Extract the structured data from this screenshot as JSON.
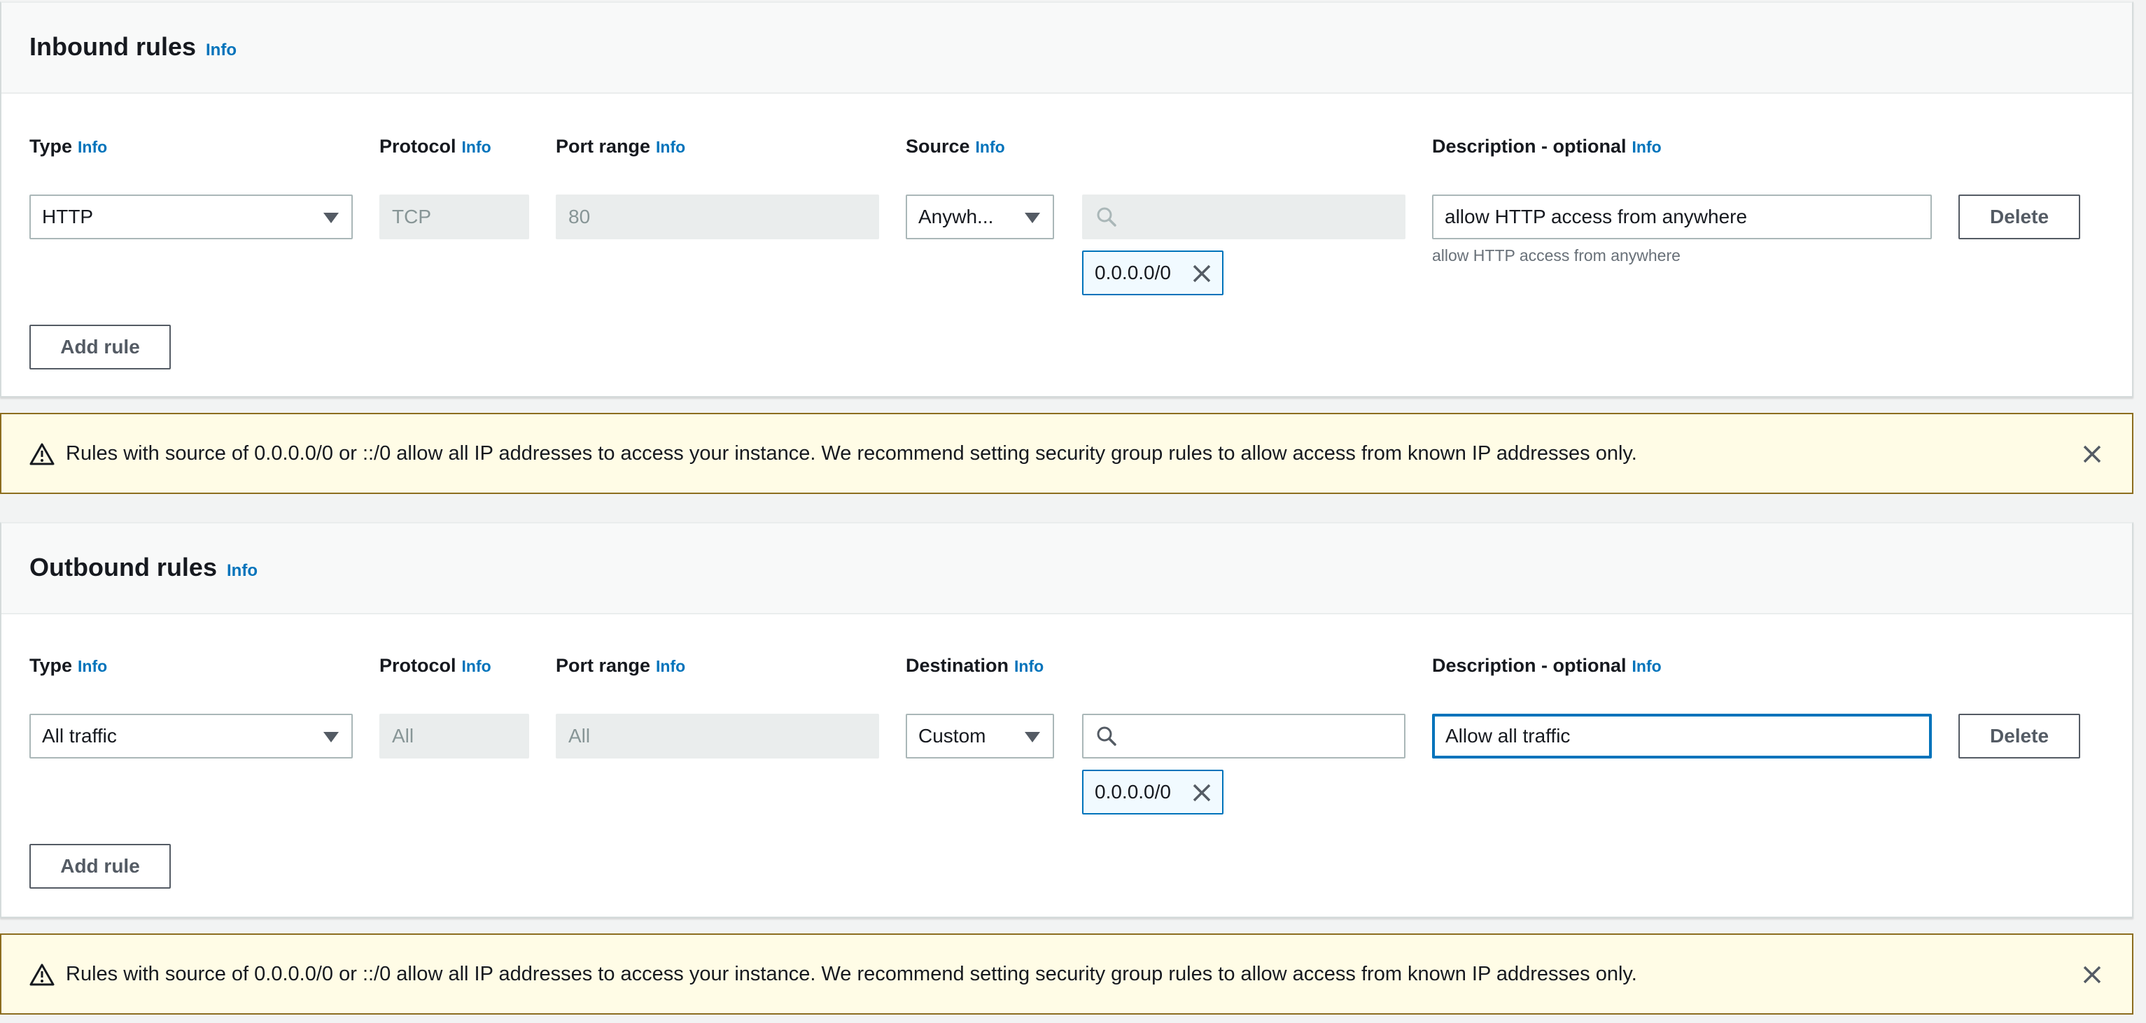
{
  "inbound": {
    "title": "Inbound rules",
    "title_info": "Info",
    "columns": {
      "type": "Type",
      "protocol": "Protocol",
      "port_range": "Port range",
      "source": "Source",
      "description": "Description - optional",
      "info": "Info"
    },
    "rule": {
      "type_value": "HTTP",
      "protocol_value": "TCP",
      "port_value": "80",
      "source_select": "Anywh...",
      "search_value": "",
      "cidr_token": "0.0.0.0/0",
      "description_value": "allow HTTP access from anywhere",
      "description_hint": "allow HTTP access from anywhere",
      "delete_label": "Delete"
    },
    "add_rule_label": "Add rule"
  },
  "outbound": {
    "title": "Outbound rules",
    "title_info": "Info",
    "columns": {
      "type": "Type",
      "protocol": "Protocol",
      "port_range": "Port range",
      "destination": "Destination",
      "description": "Description - optional",
      "info": "Info"
    },
    "rule": {
      "type_value": "All traffic",
      "protocol_value": "All",
      "port_value": "All",
      "destination_select": "Custom",
      "search_value": "",
      "cidr_token": "0.0.0.0/0",
      "description_value": "Allow all traffic",
      "delete_label": "Delete"
    },
    "add_rule_label": "Add rule"
  },
  "alerts": [
    {
      "message": "Rules with source of 0.0.0.0/0 or ::/0 allow all IP addresses to access your instance. We recommend setting security group rules to allow access from known IP addresses only.",
      "icon": "warning-icon"
    },
    {
      "message": "Rules with source of 0.0.0.0/0 or ::/0 allow all IP addresses to access your instance. We recommend setting security group rules to allow access from known IP addresses only.",
      "icon": "warning-icon"
    }
  ],
  "colors": {
    "link": "#0073bb",
    "alert_bg": "#fffce6",
    "alert_border": "#8c6d1f"
  }
}
